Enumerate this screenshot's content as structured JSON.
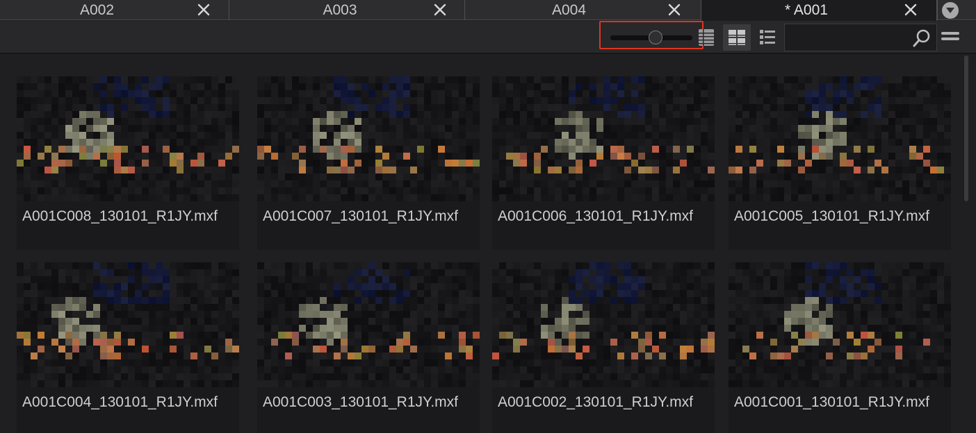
{
  "tabs": [
    {
      "label": "A002",
      "active": false
    },
    {
      "label": "A003",
      "active": false
    },
    {
      "label": "A004",
      "active": false
    },
    {
      "label": "* A001",
      "active": true
    }
  ],
  "toolbar": {
    "zoom_slider_value": 0.55,
    "view_modes": [
      "filmstrip-view-icon",
      "grid-view-icon",
      "list-view-icon"
    ],
    "active_view": "grid-view-icon",
    "search": {
      "value": "",
      "placeholder": ""
    },
    "highlight_color": "#e23420"
  },
  "clips": [
    {
      "name": "A001C008_130101_R1JY.mxf"
    },
    {
      "name": "A001C007_130101_R1JY.mxf"
    },
    {
      "name": "A001C006_130101_R1JY.mxf"
    },
    {
      "name": "A001C005_130101_R1JY.mxf"
    },
    {
      "name": "A001C004_130101_R1JY.mxf"
    },
    {
      "name": "A001C003_130101_R1JY.mxf"
    },
    {
      "name": "A001C002_130101_R1JY.mxf"
    },
    {
      "name": "A001C001_130101_R1JY.mxf"
    }
  ]
}
